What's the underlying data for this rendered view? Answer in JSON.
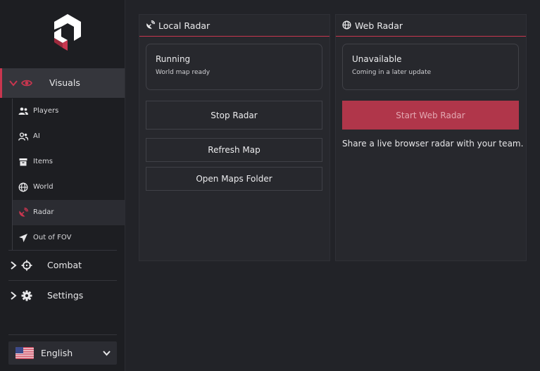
{
  "sidebar": {
    "groups": [
      {
        "label": "Visuals"
      },
      {
        "label": "Combat"
      },
      {
        "label": "Settings"
      }
    ],
    "visuals_items": [
      {
        "label": "Players"
      },
      {
        "label": "AI"
      },
      {
        "label": "Items"
      },
      {
        "label": "World"
      },
      {
        "label": "Radar"
      },
      {
        "label": "Out of FOV"
      }
    ],
    "language": {
      "label": "English"
    }
  },
  "local_radar": {
    "title": "Local Radar",
    "status_title": "Running",
    "status_sub": "World map ready",
    "buttons": {
      "stop": "Stop Radar",
      "refresh": "Refresh Map",
      "open_folder": "Open Maps Folder"
    }
  },
  "web_radar": {
    "title": "Web Radar",
    "status_title": "Unavailable",
    "status_sub": "Coming in a later update",
    "start_button": "Start Web Radar",
    "note": "Share a live browser radar with your team."
  },
  "colors": {
    "accent": "#c8364f",
    "background": "#222328",
    "sidebar": "#1d1e22",
    "panel": "#27282d"
  }
}
